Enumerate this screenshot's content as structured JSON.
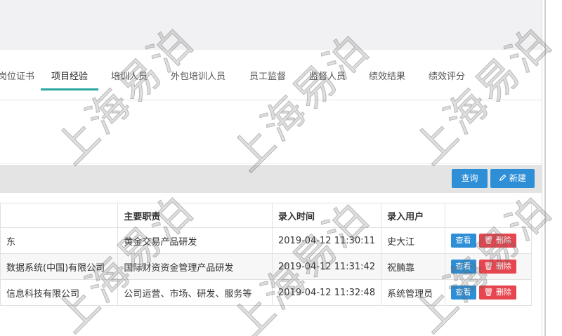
{
  "tabs": [
    {
      "label": "岗位证书"
    },
    {
      "label": "项目经验",
      "active": true
    },
    {
      "label": "培训人员"
    },
    {
      "label": "外包培训人员"
    },
    {
      "label": "员工监督"
    },
    {
      "label": "监督人员"
    },
    {
      "label": "绩效结果"
    },
    {
      "label": "绩效评分"
    }
  ],
  "toolbar": {
    "query_label": "查询",
    "new_label": "新建"
  },
  "table": {
    "headers": [
      "",
      "主要职责",
      "录入时间",
      "录入用户",
      ""
    ],
    "rows": [
      {
        "company": "东",
        "duty": "黄金交易产品研发",
        "time": "2019-04-12 11:30:11",
        "user": "史大江"
      },
      {
        "company": "数据系统(中国)有限公司",
        "duty": "国际财资资金管理产品研发",
        "time": "2019-04-12 11:31:42",
        "user": "祝腩靠"
      },
      {
        "company": "信息科技有限公司",
        "duty": "公司运营、市场、研发、服务等",
        "time": "2019-04-12 11:32:48",
        "user": "系统管理员"
      }
    ],
    "view_label": "查看",
    "delete_label": "删除"
  },
  "watermark": {
    "text": "上海易泊"
  },
  "colors": {
    "accent": "#2aa7a0",
    "primary_button": "#2e8fd6",
    "danger_button": "#e6464f"
  }
}
